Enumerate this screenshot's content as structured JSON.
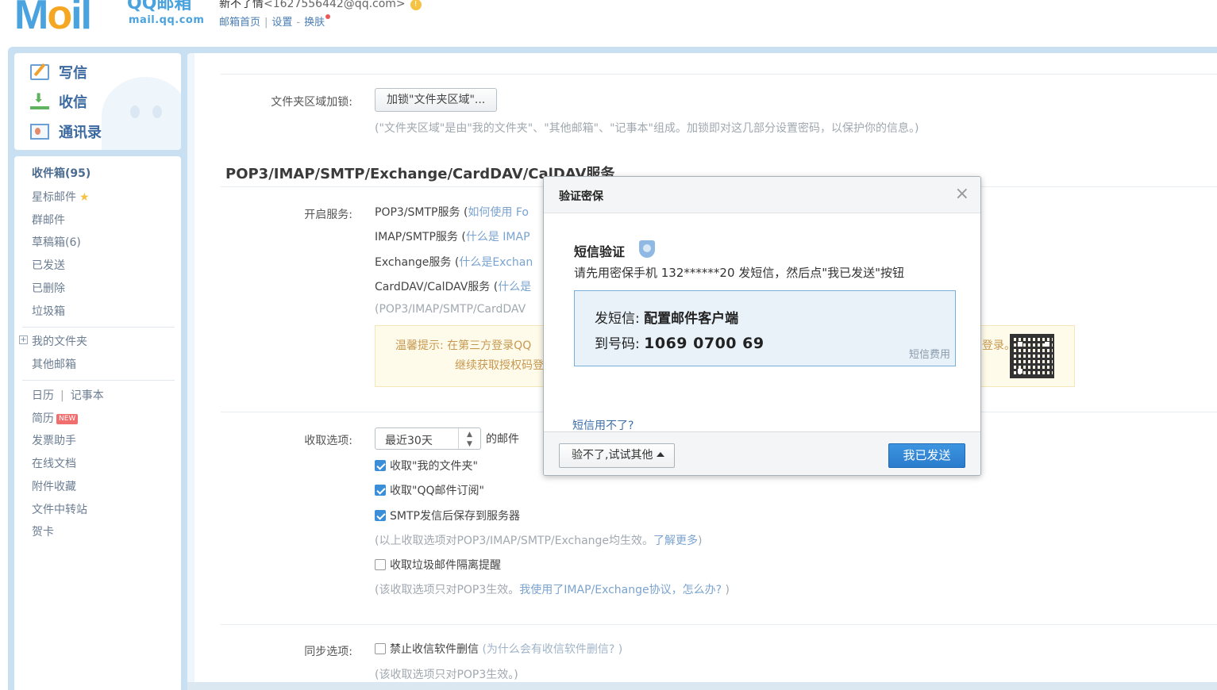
{
  "header": {
    "logo_mail": "Mail",
    "logo_qq": "QQ邮箱",
    "logo_domain": "mail.qq.com",
    "user_name": "新不了情",
    "user_email": "<1627556442@qq.com>",
    "links": [
      "邮箱首页",
      "设置",
      "换肤"
    ]
  },
  "sidebar": {
    "actions": [
      "写信",
      "收信",
      "通讯录"
    ],
    "inbox": "收件箱(95)",
    "starred": "星标邮件",
    "group": "群邮件",
    "drafts": "草稿箱(6)",
    "sent": "已发送",
    "deleted": "已删除",
    "trash": "垃圾箱",
    "my_folders": "我的文件夹",
    "other_mailbox": "其他邮箱",
    "calendar": "日历",
    "notes": "记事本",
    "resume": "简历",
    "new_badge": "NEW",
    "invoice": "发票助手",
    "online_docs": "在线文档",
    "attachments": "附件收藏",
    "transfer": "文件中转站",
    "greeting": "贺卡"
  },
  "main": {
    "folder_lock_label": "文件夹区域加锁:",
    "folder_lock_button": "加锁\"文件夹区域\"...",
    "folder_lock_desc": "(\"文件夹区域\"是由\"我的文件夹\"、\"其他邮箱\"、\"记事本\"组成。加锁即对这几部分设置密码，以保护你的信息。)",
    "section_title": "POP3/IMAP/SMTP/Exchange/CardDAV/CalDAV服务",
    "open_service_label": "开启服务:",
    "services": [
      {
        "name": "POP3/SMTP服务 (",
        "link": "如何使用 Fo"
      },
      {
        "name": "IMAP/SMTP服务 (",
        "link": "什么是 IMAP"
      },
      {
        "name": "Exchange服务 (",
        "link": "什么是Exchan"
      },
      {
        "name": "CardDAV/CalDAV服务 (",
        "link": "什么是"
      }
    ],
    "services_note": "(POP3/IMAP/SMTP/CardDAV",
    "tip_label": "温馨提示:",
    "tip_line1": "在第三方登录QQ",
    "tip_line1_end": "登录。",
    "tip_line2": "继续获取授权码登",
    "fetch_label": "收取选项:",
    "fetch_select": "最近30天",
    "fetch_suffix": "的邮件",
    "fetch_options": [
      "收取\"我的文件夹\"",
      "收取\"QQ邮件订阅\"",
      "SMTP发信后保存到服务器"
    ],
    "fetch_note_prefix": "(以上收取选项对POP3/IMAP/SMTP/Exchange均生效。",
    "fetch_note_link": "了解更多",
    "fetch_note_suffix": ")",
    "spam_option": "收取垃圾邮件隔离提醒",
    "spam_note_prefix": "(该收取选项只对POP3生效。",
    "spam_note_link": "我使用了IMAP/Exchange协议，怎么办?",
    "spam_note_suffix": " )",
    "sync_label": "同步选项:",
    "sync_option": "禁止收信软件删信",
    "sync_option_link": "(为什么会有收信软件删信? )",
    "sync_note": "(该收取选项只对POP3生效。)"
  },
  "dialog": {
    "title": "验证密保",
    "close": "×",
    "sms_title": "短信验证",
    "sms_desc": "请先用密保手机 132******20 发短信，然后点\"我已发送\"按钮",
    "send_label": "发短信: ",
    "send_content": "配置邮件客户端",
    "to_label": "到号码: ",
    "to_number": "1069 0700 69",
    "fee_link": "短信费用",
    "cant_use": "短信用不了?",
    "other_button": "验不了,试试其他",
    "sent_button": "我已发送"
  },
  "colors": {
    "frame": "#c9dff2",
    "link": "#4a7eb5",
    "primary_button": "#2a7bcc",
    "checkbox_checked": "#3b8fd8"
  },
  "icons": [
    "write-icon",
    "inbox-icon",
    "contacts-icon",
    "star-icon",
    "shield-icon",
    "close-icon",
    "caret-up-icon",
    "qr-code-icon",
    "warning-icon",
    "expand-icon"
  ]
}
